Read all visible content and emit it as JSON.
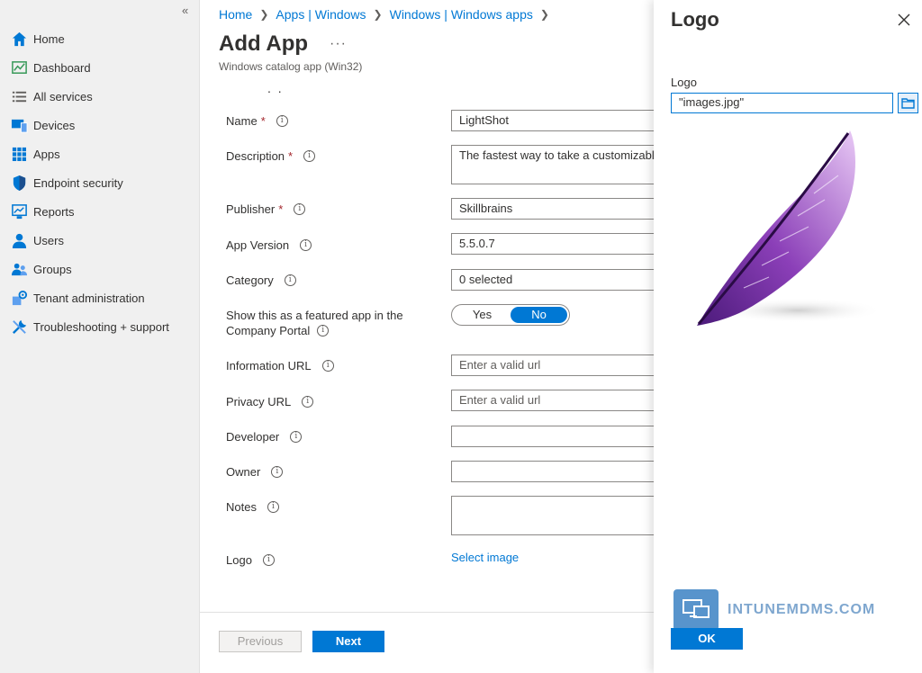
{
  "sidebar": {
    "collapse_glyph": "«",
    "items": [
      {
        "label": "Home",
        "icon": "home-icon"
      },
      {
        "label": "Dashboard",
        "icon": "dashboard-icon"
      },
      {
        "label": "All services",
        "icon": "list-icon"
      },
      {
        "label": "Devices",
        "icon": "devices-icon"
      },
      {
        "label": "Apps",
        "icon": "apps-grid-icon"
      },
      {
        "label": "Endpoint security",
        "icon": "shield-icon"
      },
      {
        "label": "Reports",
        "icon": "reports-icon"
      },
      {
        "label": "Users",
        "icon": "user-icon"
      },
      {
        "label": "Groups",
        "icon": "groups-icon"
      },
      {
        "label": "Tenant administration",
        "icon": "tenant-admin-icon"
      },
      {
        "label": "Troubleshooting + support",
        "icon": "tools-icon"
      }
    ]
  },
  "breadcrumb": [
    "Home",
    "Apps | Windows",
    "Windows | Windows apps"
  ],
  "page": {
    "title": "Add App",
    "more": "···",
    "subtitle": "Windows catalog app (Win32)",
    "dots": ". ."
  },
  "form": {
    "name_label": "Name",
    "name_value": "LightShot",
    "description_label": "Description",
    "description_value": "The fastest way to take a customizable",
    "publisher_label": "Publisher",
    "publisher_value": "Skillbrains",
    "app_version_label": "App Version",
    "app_version_value": "5.5.0.7",
    "category_label": "Category",
    "category_value": "0 selected",
    "featured_label_1": "Show this as a featured app in the",
    "featured_label_2": "Company Portal",
    "featured_yes": "Yes",
    "featured_no": "No",
    "featured_selected": "No",
    "info_url_label": "Information URL",
    "info_url_placeholder": "Enter a valid url",
    "privacy_url_label": "Privacy URL",
    "privacy_url_placeholder": "Enter a valid url",
    "developer_label": "Developer",
    "owner_label": "Owner",
    "notes_label": "Notes",
    "logo_label": "Logo",
    "select_image": "Select image",
    "required_mark": "*",
    "info_glyph": "i"
  },
  "footer": {
    "previous": "Previous",
    "next": "Next"
  },
  "panel": {
    "title": "Logo",
    "field_label": "Logo",
    "file_value": "\"images.jpg\"",
    "watermark": "INTUNEMDMS.COM",
    "ok": "OK"
  },
  "colors": {
    "accent": "#0078d4",
    "required": "#a4262c",
    "feather": "#8b3fb8"
  }
}
